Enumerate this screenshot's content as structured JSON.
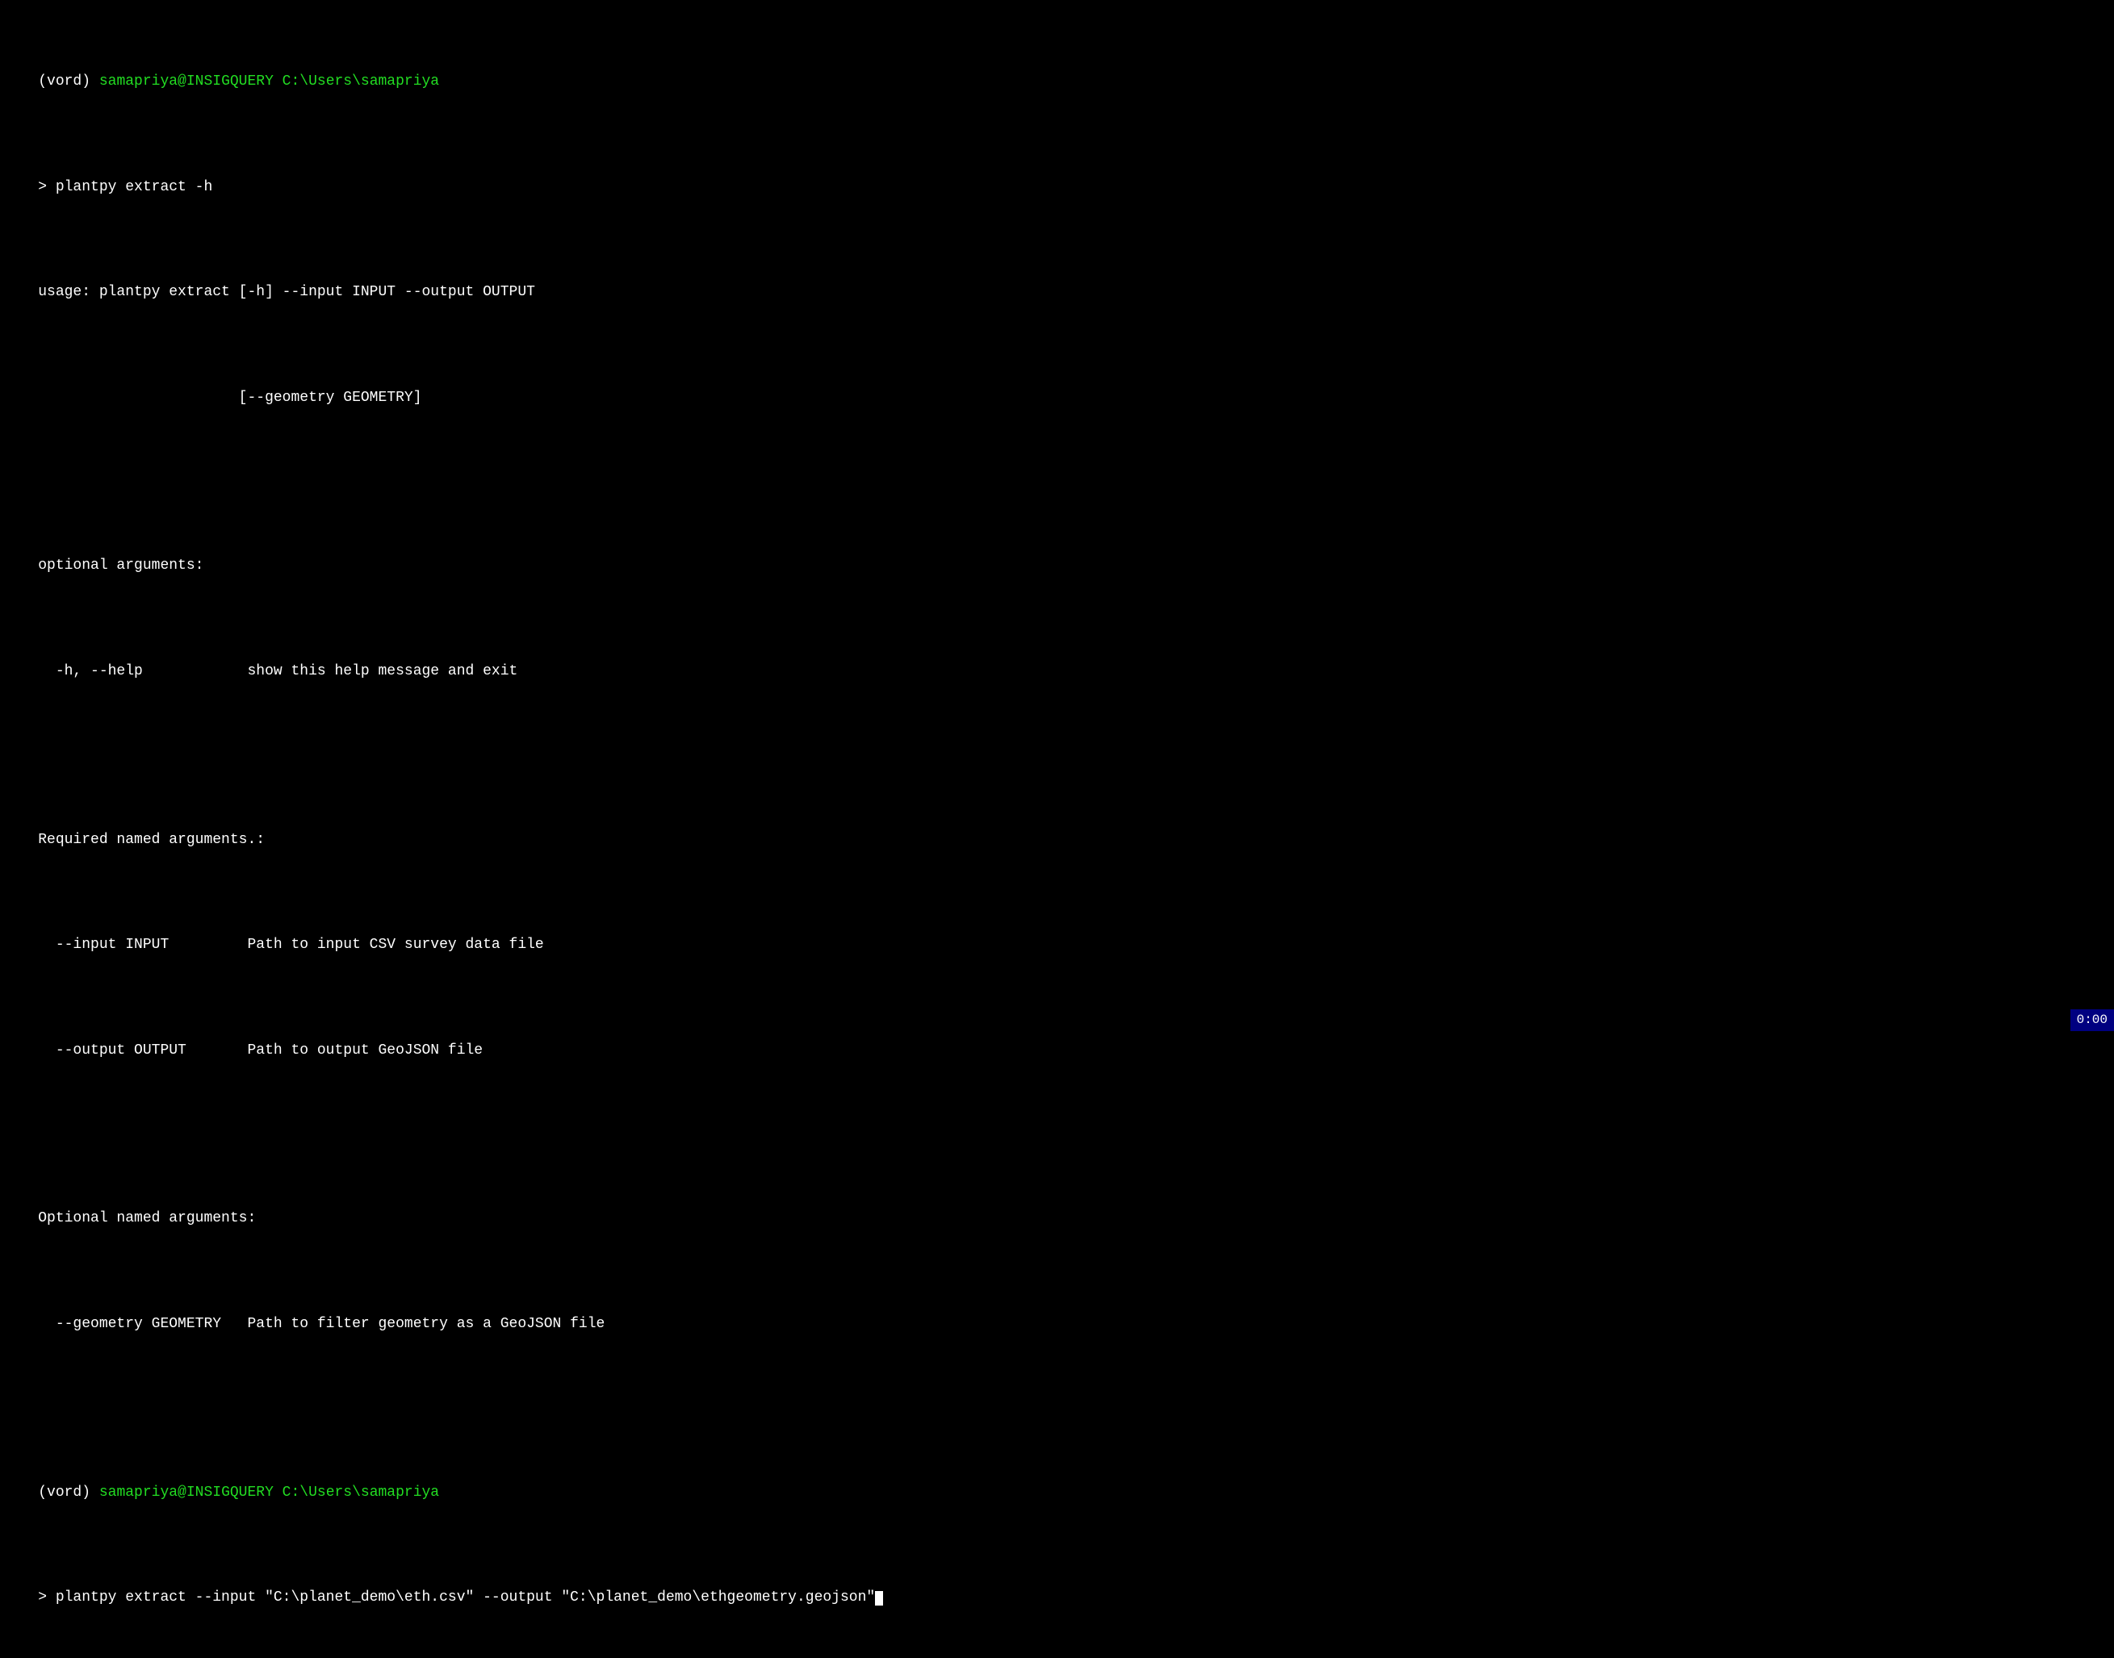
{
  "terminal": {
    "lines": [
      {
        "type": "prompt_prefix",
        "text": "(vord) ",
        "color": "white",
        "suffix_text": "samapriya@INSIGQUERY C:\\Users\\samapriya",
        "suffix_color": "green"
      },
      {
        "type": "command",
        "text": "> plantpy extract -h"
      },
      {
        "type": "output",
        "text": "usage: plantpy extract [-h] --input INPUT --output OUTPUT"
      },
      {
        "type": "output",
        "text": "                       [--geometry GEOMETRY]"
      },
      {
        "type": "blank"
      },
      {
        "type": "output",
        "text": "optional arguments:"
      },
      {
        "type": "output",
        "text": "  -h, --help            show this help message and exit"
      },
      {
        "type": "blank"
      },
      {
        "type": "output",
        "text": "Required named arguments.:"
      },
      {
        "type": "output",
        "text": "  --input INPUT         Path to input CSV survey data file"
      },
      {
        "type": "output",
        "text": "  --output OUTPUT       Path to output GeoJSON file"
      },
      {
        "type": "blank"
      },
      {
        "type": "output",
        "text": "Optional named arguments:"
      },
      {
        "type": "output",
        "text": "  --geometry GEOMETRY   Path to filter geometry as a GeoJSON file"
      },
      {
        "type": "blank"
      },
      {
        "type": "prompt_prefix",
        "text": "(vord) ",
        "color": "white",
        "suffix_text": "samapriya@INSIGQUERY C:\\Users\\samapriya",
        "suffix_color": "green"
      },
      {
        "type": "command_with_cursor",
        "text": "> plantpy extract --input \"C:\\planet_demo\\eth.csv\" --output \"C:\\planet_demo\\ethgeometry.geojson\""
      }
    ]
  },
  "status_bar": {
    "text": "0:00"
  }
}
